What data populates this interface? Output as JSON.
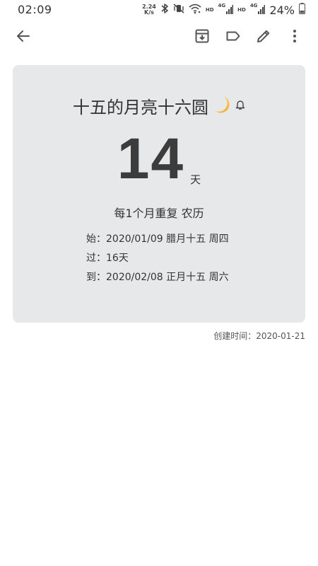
{
  "status_bar": {
    "time": "02:09",
    "net_speed_value": "2.24",
    "net_speed_unit": "K/s",
    "hd1": "HD",
    "hd2": "HD",
    "sig1_label": "4G",
    "sig2_label": "4G",
    "battery_percent": "24%"
  },
  "toolbar": {
    "icons": [
      "back-arrow-icon",
      "archive-icon",
      "label-icon",
      "edit-icon",
      "more-vert-icon"
    ]
  },
  "card": {
    "title": "十五的月亮十六圆",
    "title_emoji": "🌙",
    "days_count": "14",
    "days_unit": "天",
    "repeat_text": "每1个月重复 农历",
    "details": [
      "始：2020/01/09 腊月十五 周四",
      "过：16天",
      "到：2020/02/08 正月十五 周六"
    ],
    "background_color": "#e7e8ea"
  },
  "created_text": "创建时间：2020-01-21"
}
